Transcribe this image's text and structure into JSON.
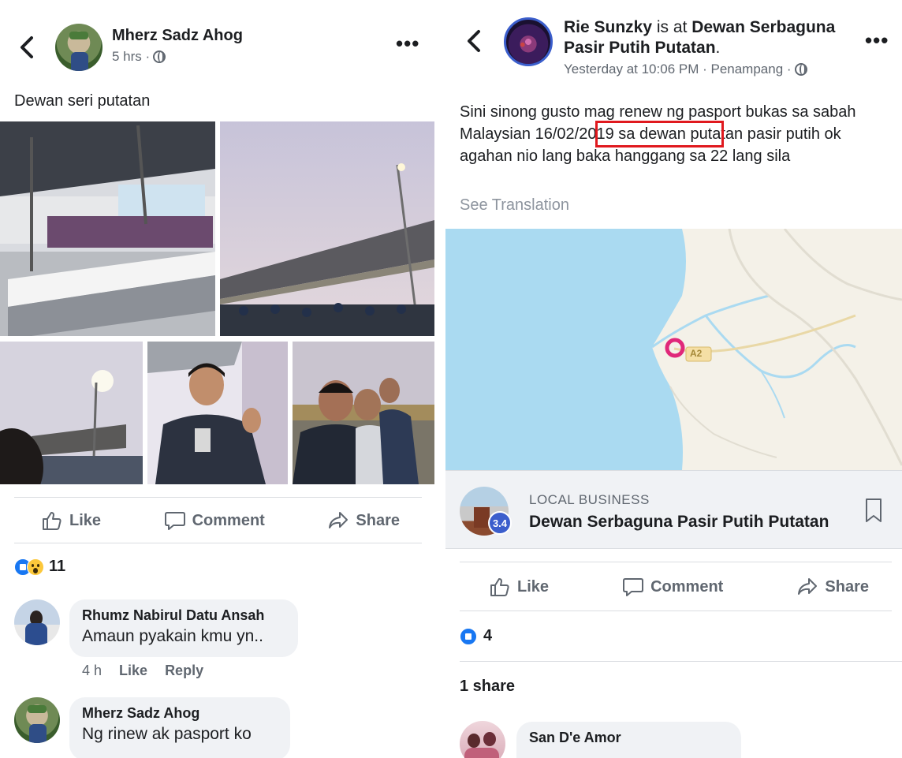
{
  "left_post": {
    "author": "Mherz Sadz Ahog",
    "time": "5 hrs ·",
    "text": "Dewan seri putatan",
    "actions": {
      "like": "Like",
      "comment": "Comment",
      "share": "Share"
    },
    "reaction_count": "11",
    "comments": [
      {
        "name": "Rhumz Nabirul Datu Ansah",
        "text": "Amaun pyakain kmu yn..",
        "time": "4 h",
        "like": "Like",
        "reply": "Reply"
      },
      {
        "name": "Mherz Sadz Ahog",
        "text": "Ng rinew ak pasport ko"
      }
    ]
  },
  "right_post": {
    "author": "Rie Sunzky",
    "is_at": "is at",
    "place": "Dewan Serbaguna Pasir Putih Putatan",
    "time": "Yesterday at 10:06 PM · Penampang ·",
    "text_part1": "Sini sinong gusto  mag  renew  ng  pasport  bukas sa sabah  Malaysian ",
    "text_highlight": "16/02/2019 sa",
    "text_part2": " dewan  putatan pasir  putih ok agahan  nio lang baka hanggang sa  22 lang  sila",
    "see_translation": "See Translation",
    "map_road_label": "A2",
    "place_category": "LOCAL BUSINESS",
    "place_name": "Dewan Serbaguna Pasir Putih Putatan",
    "place_rating": "3.4",
    "actions": {
      "like": "Like",
      "comment": "Comment",
      "share": "Share"
    },
    "reaction_count": "4",
    "shares": "1 share",
    "comment_name": "San D'e Amor"
  },
  "colors": {
    "highlight": "#e0191e",
    "like_blue": "#1877f2",
    "map_water": "#aadaf1",
    "map_land": "#f4f1e8"
  }
}
